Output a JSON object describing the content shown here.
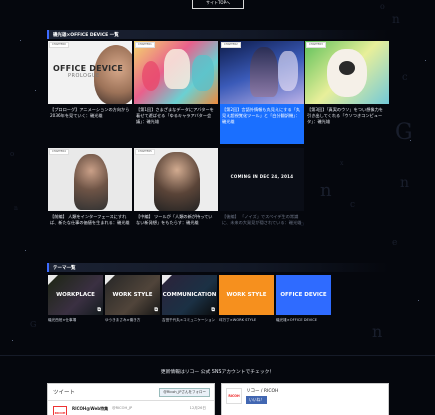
{
  "header": {
    "site_top_label": "サイトTOPへ"
  },
  "section1": {
    "title": "磯光雄×OFFICE DEVICE 一覧"
  },
  "cards": [
    {
      "chapter": "CHAPTER0",
      "thumb_title": "OFFICE DEVICE",
      "thumb_sub": "PROLOGUE",
      "caption": "【プロローグ】アニメーションの方向から2036年を見ていく：磯光雄"
    },
    {
      "chapter": "CHAPTER1",
      "caption": "【第1回】さまざまなデータにアバターを着せて遊ばせる「ゆるキャラアバター会議」：磯光雄"
    },
    {
      "chapter": "CHAPTER2",
      "caption": "【第2回】言語外情報も丸見えにする「丸見え超視覚化ツール」と「白分翻訳機」：磯光雄"
    },
    {
      "chapter": "CHAPTER3",
      "caption": "【第3回】「真実のウソ」をつい想像力を引き出してくれる「ウソつきコンピュータ」：磯光雄"
    },
    {
      "chapter": "CHAPTER4",
      "caption": "【前編】 人類をインターフェースにすれば、新たな仕事の価値を生まれる：磯光雄"
    },
    {
      "chapter": "CHAPTER5",
      "caption": "【中編】 ツールが「人類の新が持っていない新発想」をもたらす：磯光雄"
    },
    {
      "chapter": "",
      "soon": "COMING IN DEC 24, 2014",
      "caption": "【後編】 「ノイズ」でスペイデ生の常識に、未来の大発見が隠されている：磯光雄"
    }
  ],
  "section2": {
    "title": "テーマ一覧"
  },
  "themes": [
    {
      "label": "WORKPLACE",
      "caption": "磯光西班×仕事場"
    },
    {
      "label": "WORK STYLE",
      "caption": "ゆうきまさみ×働き方"
    },
    {
      "label": "COMMUNICATION",
      "caption": "吉田千代丸×コミュニケーション"
    },
    {
      "label": "WORK STYLE",
      "caption": "坪万丁×WORK STYLE"
    },
    {
      "label": "OFFICE DEVICE",
      "caption": "磯光雄×OFFICE DEVICE"
    }
  ],
  "follow_text": "更新情報はリコー 公式 SNSアカウントでチェック！",
  "twitter": {
    "title": "ツイート",
    "follow_button": "@Ricoh_JPさんをフォロー",
    "avatar_text": "RICOH",
    "name": "RICOH@Web特集",
    "handle": "@RICOH_JP",
    "date": "12月26日"
  },
  "facebook": {
    "logo_text": "RICOH",
    "name": "リコー / RICOH",
    "like_button": "いいね！"
  }
}
